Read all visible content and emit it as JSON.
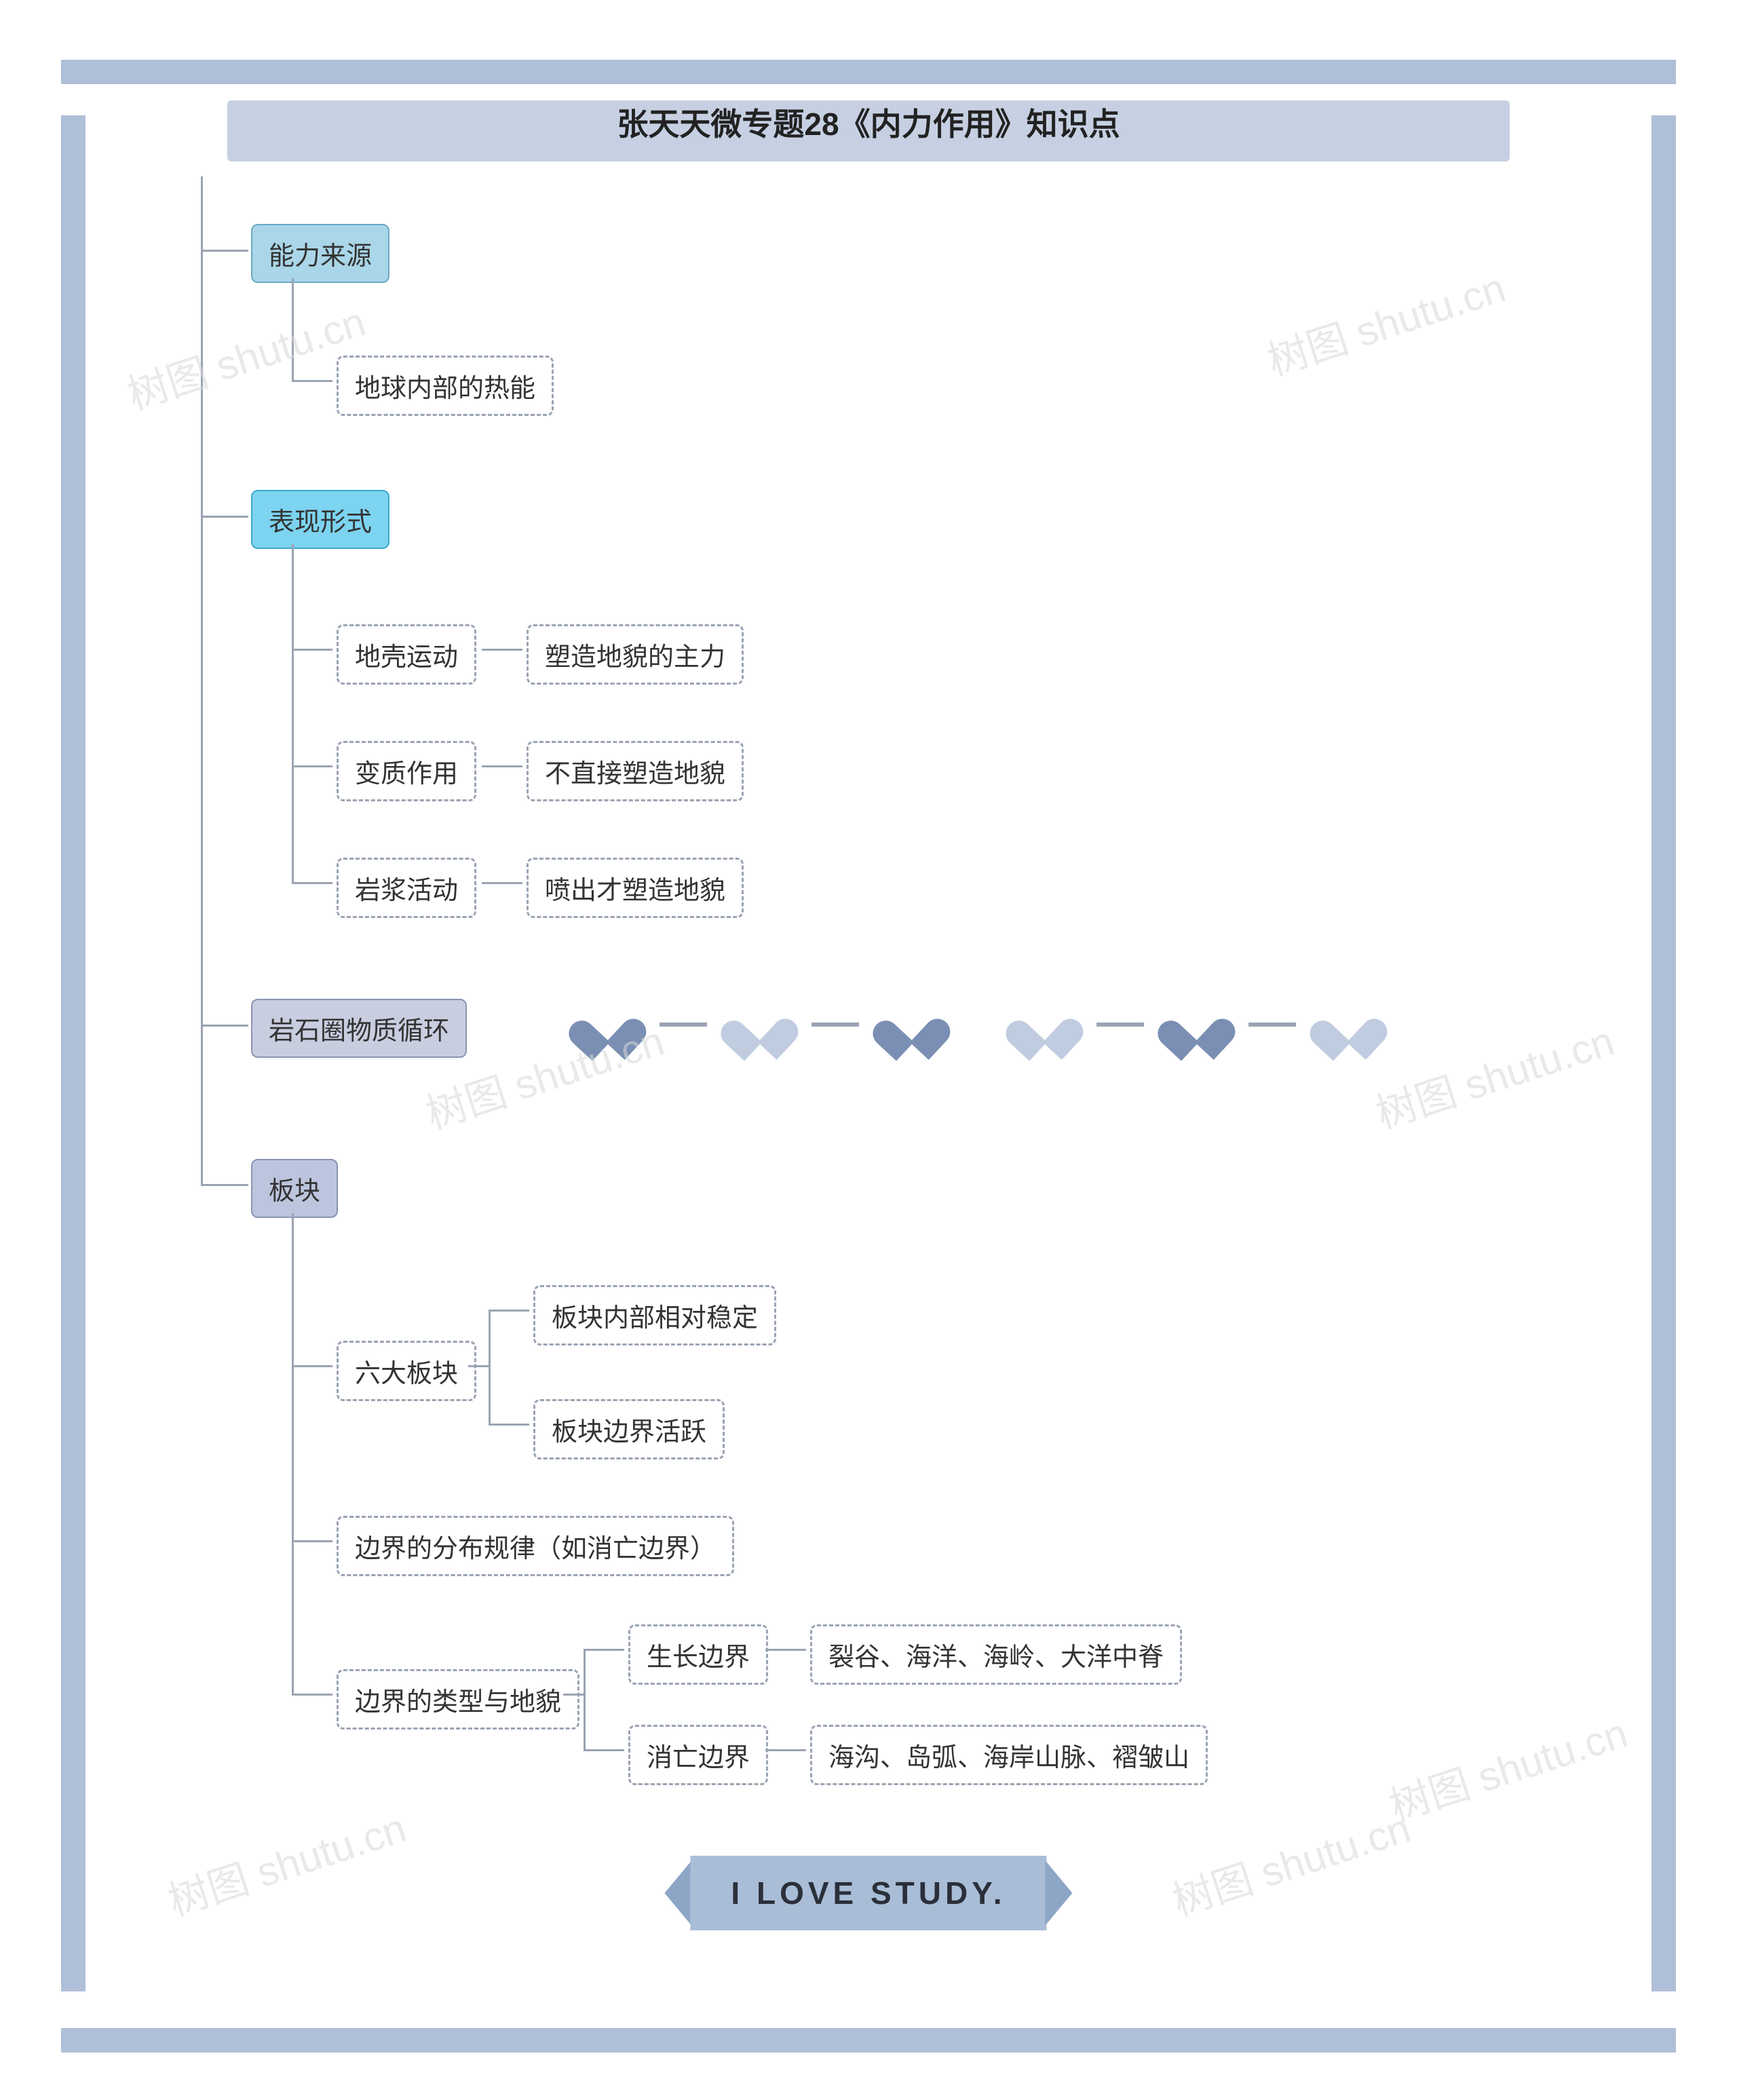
{
  "title": "张天天微专题28《内力作用》知识点",
  "watermark": "树图 shutu.cn",
  "footer_text": "I LOVE STUDY.",
  "nodes": {
    "c1": "能力来源",
    "c1_1": "地球内部的热能",
    "c2": "表现形式",
    "c2_1": "地壳运动",
    "c2_1d": "塑造地貌的主力",
    "c2_2": "变质作用",
    "c2_2d": "不直接塑造地貌",
    "c2_3": "岩浆活动",
    "c2_3d": "喷出才塑造地貌",
    "c3": "岩石圈物质循环",
    "c4": "板块",
    "c4_1": "六大板块",
    "c4_1a": "板块内部相对稳定",
    "c4_1b": "板块边界活跃",
    "c4_2": "边界的分布规律（如消亡边界）",
    "c4_3": "边界的类型与地貌",
    "c4_3a": "生长边界",
    "c4_3ad": "裂谷、海洋、海岭、大洋中脊",
    "c4_3b": "消亡边界",
    "c4_3bd": "海沟、岛弧、海岸山脉、褶皱山"
  },
  "heart_colors": [
    "#7a8fb3",
    "#bcc9de",
    "#7a8fb3",
    "#bcc9de",
    "#7a8fb3",
    "#bcc9de"
  ]
}
